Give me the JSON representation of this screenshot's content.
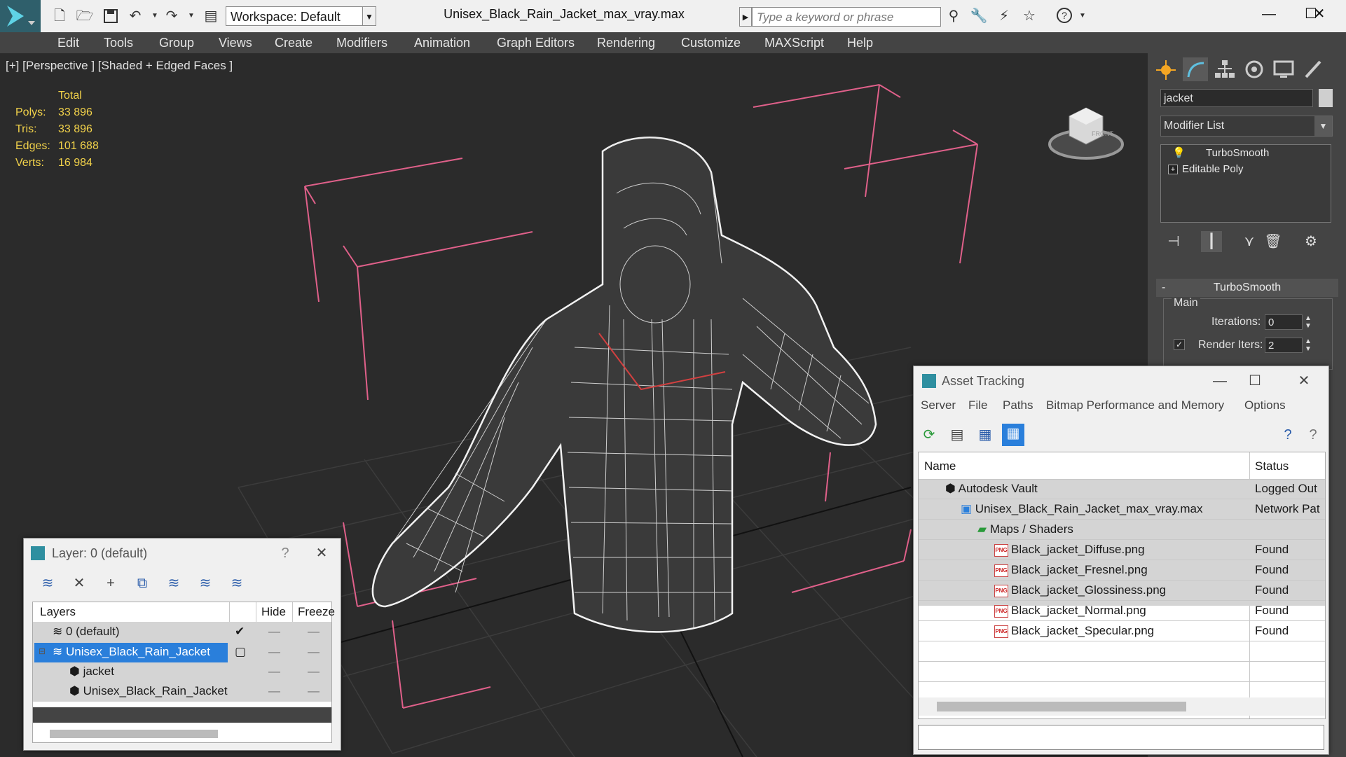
{
  "app": {
    "workspace": "Workspace: Default",
    "document_title": "Unisex_Black_Rain_Jacket_max_vray.max",
    "search_placeholder": "Type a keyword or phrase"
  },
  "menu": [
    "Edit",
    "Tools",
    "Group",
    "Views",
    "Create",
    "Modifiers",
    "Animation",
    "Graph Editors",
    "Rendering",
    "Customize",
    "MAXScript",
    "Help"
  ],
  "viewport": {
    "label": "[+] [Perspective ] [Shaded + Edged Faces ]",
    "stats": {
      "header": "Total",
      "rows": [
        {
          "label": "Polys:",
          "value": "33 896"
        },
        {
          "label": "Tris:",
          "value": "33 896"
        },
        {
          "label": "Edges:",
          "value": "101 688"
        },
        {
          "label": "Verts:",
          "value": "16 984"
        }
      ]
    },
    "viewcube_label": "FRONT"
  },
  "command_panel": {
    "object_name": "jacket",
    "modifier_list": "Modifier List",
    "stack": [
      "TurboSmooth",
      "Editable Poly"
    ],
    "rollout_title": "TurboSmooth",
    "group_main": "Main",
    "iterations_label": "Iterations:",
    "iterations_value": "0",
    "render_iters_label": "Render Iters:",
    "render_iters_value": "2"
  },
  "layer_dialog": {
    "title": "Layer: 0 (default)",
    "help": "?",
    "columns": [
      "Layers",
      "Hide",
      "Freeze"
    ],
    "rows": [
      {
        "name": "0 (default)"
      },
      {
        "name": "Unisex_Black_Rain_Jacket"
      },
      {
        "name": "jacket"
      },
      {
        "name": "Unisex_Black_Rain_Jacket"
      }
    ]
  },
  "asset_dialog": {
    "title": "Asset Tracking",
    "menu": [
      "Server",
      "File",
      "Paths",
      "Bitmap Performance and Memory",
      "Options"
    ],
    "columns": [
      "Name",
      "Status"
    ],
    "rows": [
      {
        "name": "Autodesk Vault",
        "status": "Logged Out"
      },
      {
        "name": "Unisex_Black_Rain_Jacket_max_vray.max",
        "status": "Network Pat"
      },
      {
        "name": "Maps / Shaders",
        "status": ""
      },
      {
        "name": "Black_jacket_Diffuse.png",
        "status": "Found"
      },
      {
        "name": "Black_jacket_Fresnel.png",
        "status": "Found"
      },
      {
        "name": "Black_jacket_Glossiness.png",
        "status": "Found"
      },
      {
        "name": "Black_jacket_Normal.png",
        "status": "Found"
      },
      {
        "name": "Black_jacket_Specular.png",
        "status": "Found"
      }
    ],
    "png_badge": "PNG"
  }
}
